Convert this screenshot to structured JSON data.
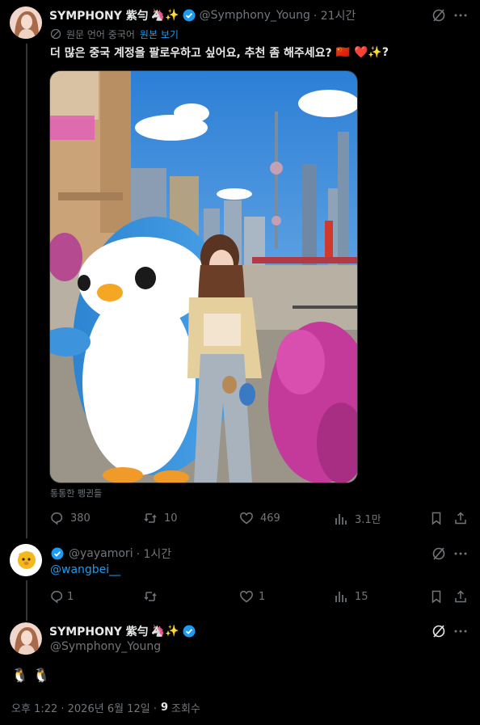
{
  "tweet1": {
    "display_name": "SYMPHONY 紫勻",
    "name_emoji": "🦄✨",
    "handle": "@Symphony_Young",
    "time": "· 21시간",
    "translate_label": "원문 언어 중국어",
    "translate_link": "원본 보기",
    "text": "더 많은 중국 계정을 팔로우하고 싶어요, 추천 좀 해주세요?",
    "text_emoji": "🇨🇳 ❤️✨?",
    "image_caption": "통통한 펭귄들",
    "replies": "380",
    "retweets": "10",
    "likes": "469",
    "views": "3.1만"
  },
  "tweet2": {
    "handle": "@yayamori",
    "time": "· 1시간",
    "mention": "@wangbei__",
    "replies": "1",
    "likes": "1",
    "views": "15"
  },
  "tweet3": {
    "display_name": "SYMPHONY 紫勻",
    "name_emoji": "🦄✨",
    "handle": "@Symphony_Young",
    "text_emoji": "🐧 🐧",
    "timestamp": "오후 1:22 · 2026년 6월 12일 ·",
    "view_count": "9",
    "view_label": "조회수"
  },
  "colors": {
    "background": "#000000",
    "text": "#e7e9ea",
    "muted": "#71767b",
    "link": "#1d9bf0",
    "verified": "#1d9bf0",
    "line": "#333639"
  }
}
